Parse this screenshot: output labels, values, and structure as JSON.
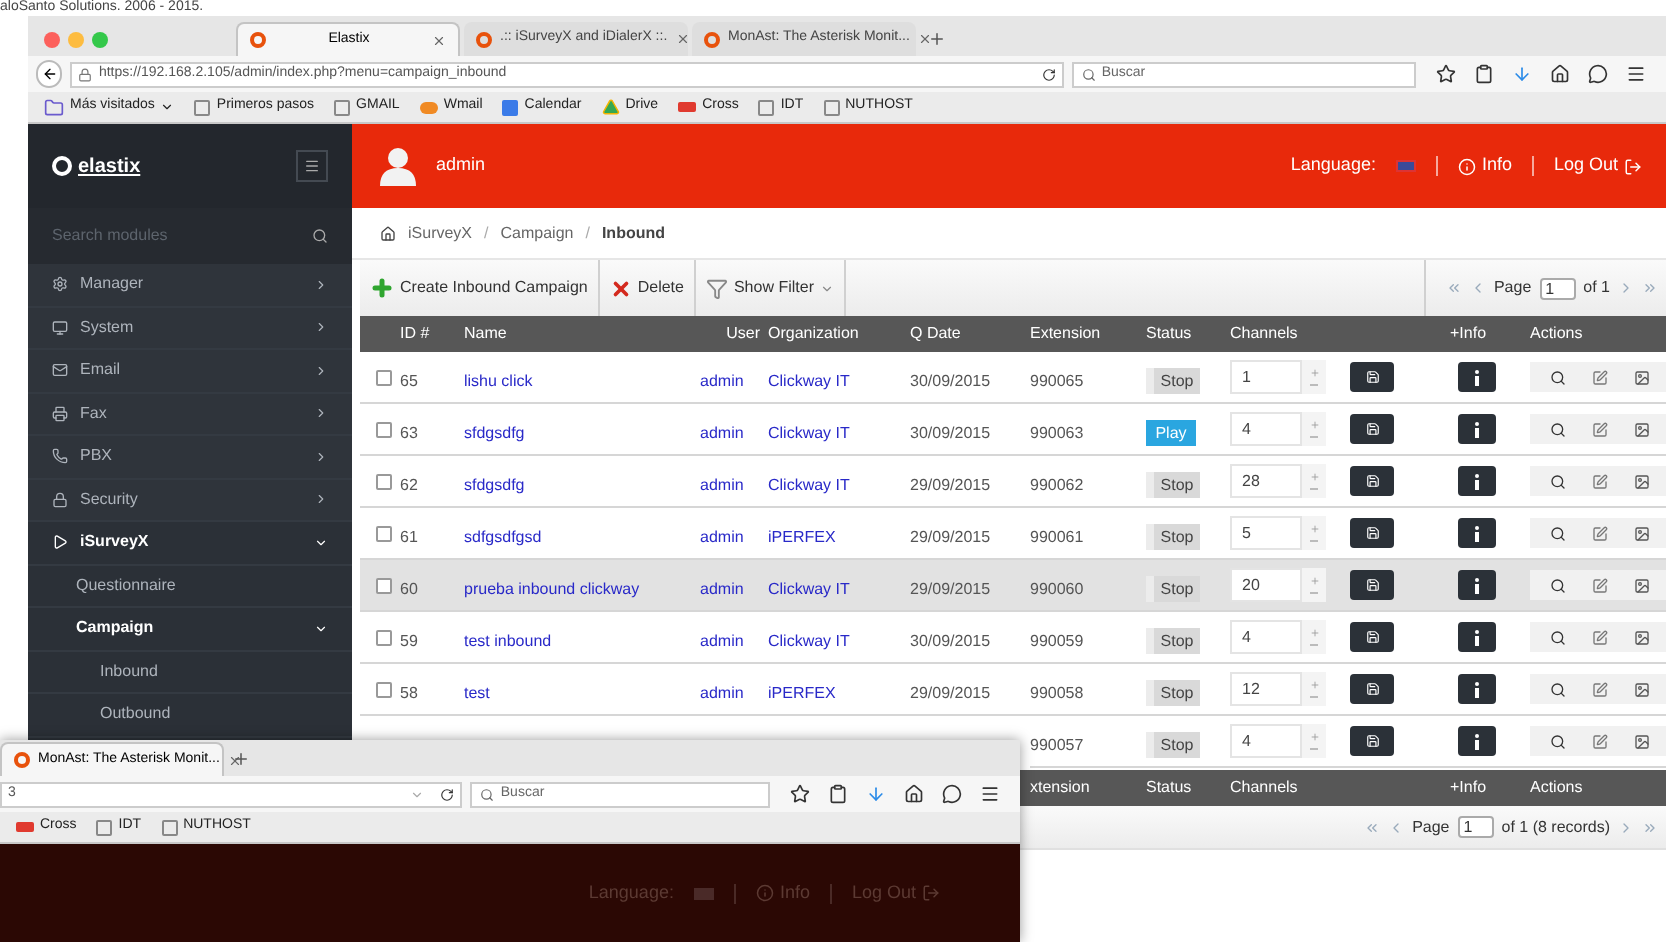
{
  "backdrop_text": "aloSanto Solutions. 2006 - 2015.",
  "browser": {
    "tabs": [
      {
        "label": "Elastix",
        "selected": true
      },
      {
        "label": ".:: iSurveyX and iDialerX ::.",
        "selected": false
      },
      {
        "label": "MonAst: The Asterisk Monit...",
        "selected": false
      }
    ],
    "url": "https://192.168.2.105/admin/index.php?menu=campaign_inbound",
    "search": {
      "placeholder": "Buscar"
    },
    "bookmarks": [
      {
        "label": "Más visitados",
        "kind": "folder"
      },
      {
        "label": "Primeros pasos",
        "kind": "page"
      },
      {
        "label": "GMAIL",
        "kind": "page"
      },
      {
        "label": "Wmail",
        "kind": "cpanel"
      },
      {
        "label": "Calendar",
        "kind": "calendar"
      },
      {
        "label": "Drive",
        "kind": "drive"
      },
      {
        "label": "Cross",
        "kind": "wc"
      },
      {
        "label": "IDT",
        "kind": "page"
      },
      {
        "label": "NUTHOST",
        "kind": "page"
      }
    ]
  },
  "sidebar": {
    "logo": "elastix",
    "search": {
      "placeholder": "Search modules"
    },
    "items": [
      {
        "label": "Manager",
        "expanded": false,
        "selected": false
      },
      {
        "label": "System",
        "expanded": false,
        "selected": false
      },
      {
        "label": "Email",
        "expanded": false,
        "selected": false
      },
      {
        "label": "Fax",
        "expanded": false,
        "selected": false
      },
      {
        "label": "PBX",
        "expanded": false,
        "selected": false
      },
      {
        "label": "Security",
        "expanded": false,
        "selected": false
      },
      {
        "label": "iSurveyX",
        "expanded": true,
        "selected": true,
        "children": [
          {
            "label": "Questionnaire",
            "kind": "link",
            "selected": false
          },
          {
            "label": "Campaign",
            "kind": "group",
            "expanded": true,
            "selected": true,
            "children": [
              {
                "label": "Inbound",
                "selected": false
              },
              {
                "label": "Outbound",
                "selected": false
              }
            ]
          }
        ]
      }
    ]
  },
  "header": {
    "user": "admin",
    "language_label": "Language:",
    "info": "Info",
    "logout": "Log Out"
  },
  "breadcrumb": {
    "separator": "/",
    "items": [
      "iSurveyX",
      "Campaign",
      "Inbound"
    ]
  },
  "toolbar": {
    "buttons": [
      {
        "label": "Create Inbound Campaign",
        "kind": "create"
      },
      {
        "label": "Delete",
        "kind": "delete"
      },
      {
        "label": "Show Filter",
        "kind": "filter"
      }
    ],
    "pagination": {
      "page_label": "Page",
      "page": "1",
      "of": "of 1"
    }
  },
  "table": {
    "columns": [
      "ID #",
      "Name",
      "User",
      "Organization",
      "Q Date",
      "Extension",
      "Status",
      "Channels",
      "+Info",
      "Actions"
    ],
    "rows": [
      {
        "id": "65",
        "name": "lishu click",
        "user": "admin",
        "organization": "Clickway IT",
        "q_date": "30/09/2015",
        "extension": "990065",
        "status": {
          "label": "Stop",
          "playing": false
        },
        "channels": "1",
        "highlighted": false
      },
      {
        "id": "63",
        "name": "sfdgsdfg",
        "user": "admin",
        "organization": "Clickway IT",
        "q_date": "30/09/2015",
        "extension": "990063",
        "status": {
          "label": "Play",
          "playing": true
        },
        "channels": "4",
        "highlighted": false
      },
      {
        "id": "62",
        "name": "sfdgsdfg",
        "user": "admin",
        "organization": "Clickway IT",
        "q_date": "29/09/2015",
        "extension": "990062",
        "status": {
          "label": "Stop",
          "playing": false
        },
        "channels": "28",
        "highlighted": false
      },
      {
        "id": "61",
        "name": "sdfgsdfgsd",
        "user": "admin",
        "organization": "iPERFEX",
        "q_date": "29/09/2015",
        "extension": "990061",
        "status": {
          "label": "Stop",
          "playing": false
        },
        "channels": "5",
        "highlighted": false
      },
      {
        "id": "60",
        "name": "prueba inbound clickway",
        "user": "admin",
        "organization": "Clickway IT",
        "q_date": "29/09/2015",
        "extension": "990060",
        "status": {
          "label": "Stop",
          "playing": false
        },
        "channels": "20",
        "highlighted": true
      },
      {
        "id": "59",
        "name": "test inbound",
        "user": "admin",
        "organization": "Clickway IT",
        "q_date": "30/09/2015",
        "extension": "990059",
        "status": {
          "label": "Stop",
          "playing": false
        },
        "channels": "4",
        "highlighted": false
      },
      {
        "id": "58",
        "name": "test",
        "user": "admin",
        "organization": "iPERFEX",
        "q_date": "29/09/2015",
        "extension": "990058",
        "status": {
          "label": "Stop",
          "playing": false
        },
        "channels": "12",
        "highlighted": false
      },
      {
        "extension": "990057",
        "status": {
          "label": "Stop",
          "playing": false
        },
        "channels": "4",
        "highlighted": false
      }
    ]
  },
  "footer": {
    "columns": [
      "xtension",
      "Status",
      "Channels",
      "+Info",
      "Actions"
    ],
    "pagination": {
      "page_label": "Page",
      "page": "1",
      "of": "of 1 (8 records)"
    }
  },
  "second_window": {
    "tabs": [
      {
        "label": "MonAst: The Asterisk Monit...",
        "selected": true
      }
    ],
    "url": "3",
    "search": {
      "placeholder": "Buscar"
    },
    "bookmarks": [
      {
        "label": "Cross",
        "kind": "wc"
      },
      {
        "label": "IDT",
        "kind": "page"
      },
      {
        "label": "NUTHOST",
        "kind": "page"
      }
    ],
    "header": {
      "language_label": "Language:",
      "info": "Info",
      "logout": "Log Out"
    }
  }
}
